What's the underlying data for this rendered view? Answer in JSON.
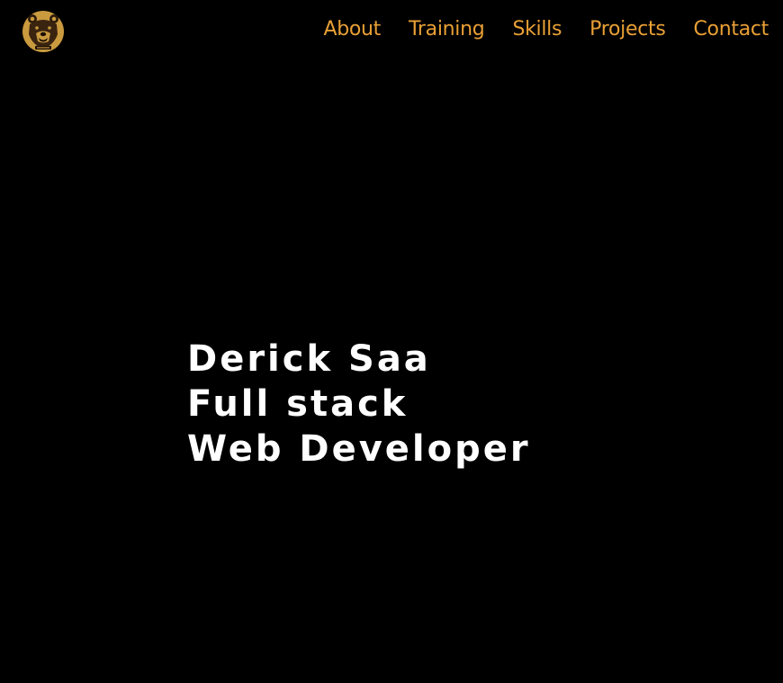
{
  "header": {
    "logo_icon": "bear-logo-icon",
    "nav": [
      {
        "label": "About"
      },
      {
        "label": "Training"
      },
      {
        "label": "Skills"
      },
      {
        "label": "Projects"
      },
      {
        "label": "Contact"
      }
    ]
  },
  "hero": {
    "lines": [
      "Derick Saa",
      "Full stack",
      "Web Developer"
    ]
  },
  "colors": {
    "background": "#000000",
    "accent": "#e9a035",
    "logo": "#c99a3e",
    "hero_text": "#ffffff"
  }
}
